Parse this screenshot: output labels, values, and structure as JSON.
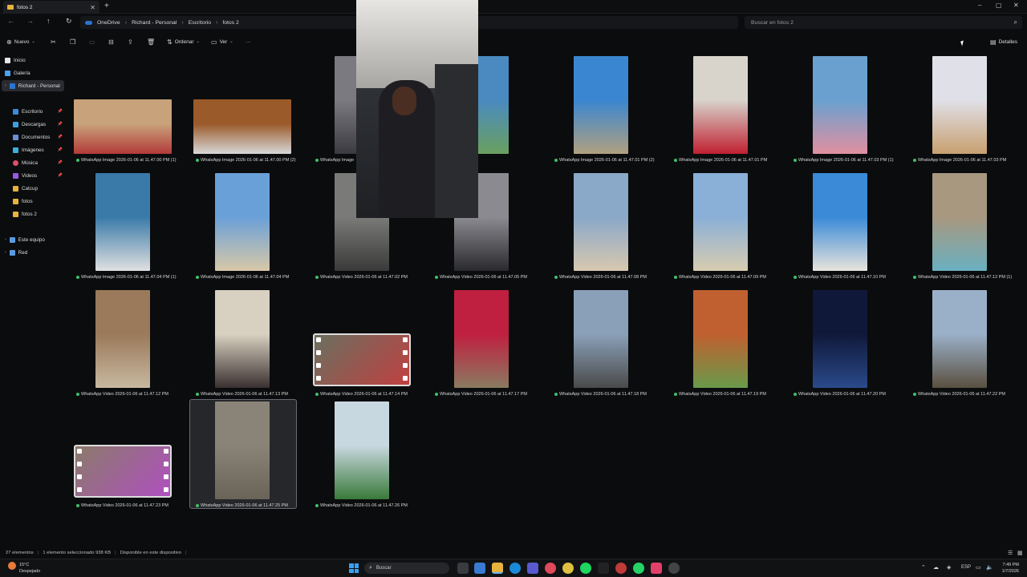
{
  "window": {
    "tab_title": "fotos 2",
    "new_tab": "+",
    "minimize": "–",
    "maximize": "▢",
    "close": "✕"
  },
  "breadcrumb": [
    "OneDrive",
    "Richard - Personal",
    "Escritorio",
    "fotos 2"
  ],
  "search": {
    "placeholder": "Buscar en fotos 2"
  },
  "toolbar": {
    "new_label": "Nuevo",
    "sort_label": "Ordenar",
    "view_label": "Ver",
    "more": "···",
    "details_label": "Detalles"
  },
  "sidebar": {
    "items": [
      {
        "label": "Inicio",
        "color": "#e6e6e6"
      },
      {
        "label": "Galería",
        "color": "#4aa3f0"
      },
      {
        "label": "Richard - Personal",
        "color": "#2b74d0"
      },
      {
        "label": "Escritorio",
        "color": "#3a8bd8"
      },
      {
        "label": "Descargas",
        "color": "#3aa0e0"
      },
      {
        "label": "Documentos",
        "color": "#6b8fd6"
      },
      {
        "label": "Imágenes",
        "color": "#3ab0e0"
      },
      {
        "label": "Música",
        "color": "#e0506a"
      },
      {
        "label": "Videos",
        "color": "#9a5ae0"
      },
      {
        "label": "Catcup",
        "color": "#e6b33c"
      },
      {
        "label": "fotos",
        "color": "#e6b33c"
      },
      {
        "label": "fotos 2",
        "color": "#e6b33c"
      },
      {
        "label": "Este equipo",
        "color": "#5a9ae0"
      },
      {
        "label": "Red",
        "color": "#5a9ae0"
      }
    ]
  },
  "files": [
    {
      "name": "WhatsApp Image 2026-01-06 at 11.47.00 PM (1)",
      "colors": [
        "#c8a27a",
        "#b33a3a"
      ]
    },
    {
      "name": "WhatsApp Image 2026-01-06 at 11.47.00 PM (2)",
      "colors": [
        "#9a5a2a",
        "#d8d8d8"
      ]
    },
    {
      "name": "WhatsApp Image",
      "colors": [
        "#7a7a80",
        "#3a3a40"
      ]
    },
    {
      "name": "11.47.01 PM",
      "colors": [
        "#4a8ac0",
        "#6aa060"
      ]
    },
    {
      "name": "WhatsApp Image 2026-01-06 at 11.47.01 PM (2)",
      "colors": [
        "#3a86d0",
        "#b0a080"
      ]
    },
    {
      "name": "WhatsApp Image 2026-01-06 at 11.47.01 PM",
      "colors": [
        "#d8d4cc",
        "#c02030"
      ]
    },
    {
      "name": "WhatsApp Image 2026-01-06 at 11.47.03 PM (1)",
      "colors": [
        "#6aa0d0",
        "#e090a0"
      ]
    },
    {
      "name": "WhatsApp Image 2026-01-06 at 11.47.03 PM",
      "colors": [
        "#e0e0e8",
        "#c8a070"
      ]
    },
    {
      "name": "WhatsApp Image 2026-01-06 at 11.47.04 PM (1)",
      "colors": [
        "#3a7aa8",
        "#e0e0e0"
      ]
    },
    {
      "name": "WhatsApp Image 2026-01-06 at 11.47.04 PM",
      "colors": [
        "#6aa0d8",
        "#d8c8a8"
      ]
    },
    {
      "name": "WhatsApp Video 2026-01-06 at 11.47.02 PM",
      "colors": [
        "#7a7a78",
        "#3a3a3a"
      ]
    },
    {
      "name": "WhatsApp Video 2026-01-06 at 11.47.05 PM",
      "colors": [
        "#8a8a90",
        "#2a2a2e"
      ]
    },
    {
      "name": "WhatsApp Video 2026-01-06 at 11.47.08 PM",
      "colors": [
        "#8aa8c8",
        "#d8c8b0"
      ]
    },
    {
      "name": "WhatsApp Video 2026-01-06 at 11.47.09 PM",
      "colors": [
        "#8ab0d8",
        "#d8ccb0"
      ]
    },
    {
      "name": "WhatsApp Video 2026-01-06 at 11.47.10 PM",
      "colors": [
        "#3a8ad8",
        "#e8e4dc"
      ]
    },
    {
      "name": "WhatsApp Video 2026-01-06 at 11.47.12 PM (1)",
      "colors": [
        "#a89880",
        "#6ab0c0"
      ]
    },
    {
      "name": "WhatsApp Video 2026-01-06 at 11.47.12 PM",
      "colors": [
        "#9a7a5a",
        "#c8b8a0"
      ]
    },
    {
      "name": "WhatsApp Video 2026-01-06 at 11.47.13 PM",
      "colors": [
        "#d8d0c0",
        "#3a3030"
      ]
    },
    {
      "name": "WhatsApp Video 2026-01-06 at 11.47.14 PM",
      "colors": [
        "#6a7060",
        "#c04040"
      ]
    },
    {
      "name": "WhatsApp Video 2026-01-06 at 11.47.17 PM",
      "colors": [
        "#c02040",
        "#8a7a60"
      ]
    },
    {
      "name": "WhatsApp Video 2026-01-06 at 11.47.18 PM",
      "colors": [
        "#8aa0b8",
        "#4a4a4a"
      ]
    },
    {
      "name": "WhatsApp Video 2026-01-06 at 11.47.19 PM",
      "colors": [
        "#c06030",
        "#6a9a4a"
      ]
    },
    {
      "name": "WhatsApp Video 2026-01-06 at 11.47.20 PM",
      "colors": [
        "#10183a",
        "#2a4a8a"
      ]
    },
    {
      "name": "WhatsApp Video 2026-01-06 at 11.47.22 PM",
      "colors": [
        "#9ab0c8",
        "#5a5040"
      ]
    },
    {
      "name": "WhatsApp Video 2026-01-06 at 11.47.23 PM",
      "colors": [
        "#8a7a6a",
        "#b050c0"
      ]
    },
    {
      "name": "WhatsApp Video 2026-01-06 at 11.47.25 PM",
      "colors": [
        "#8a8478",
        "#6a6458"
      ]
    },
    {
      "name": "WhatsApp Video 2026-01-06 at 11.47.26 PM",
      "colors": [
        "#c8d8e0",
        "#3a7a3a"
      ]
    }
  ],
  "status": {
    "count": "27 elementos",
    "selected": "1 elemento seleccionado  938 KB",
    "availability": "Disponible en este dispositivo"
  },
  "taskbar": {
    "weather_temp": "15°C",
    "weather_desc": "Despejado",
    "search_label": "Buscar",
    "lang": "ESP",
    "time": "7:49 PM",
    "date": "1/7/2026"
  }
}
